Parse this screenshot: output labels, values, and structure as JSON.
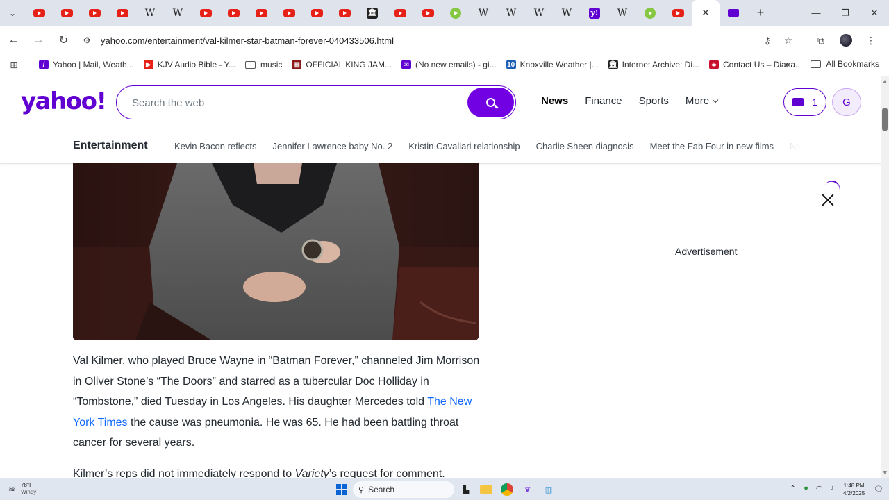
{
  "browser": {
    "tabs": [
      {
        "icon": "youtube-icon",
        "kind": "yt"
      },
      {
        "icon": "youtube-icon",
        "kind": "yt"
      },
      {
        "icon": "youtube-icon",
        "kind": "yt"
      },
      {
        "icon": "youtube-icon",
        "kind": "yt"
      },
      {
        "icon": "wikipedia-icon",
        "kind": "wiki"
      },
      {
        "icon": "wikipedia-icon",
        "kind": "wiki"
      },
      {
        "icon": "youtube-icon",
        "kind": "yt"
      },
      {
        "icon": "youtube-icon",
        "kind": "yt"
      },
      {
        "icon": "youtube-icon",
        "kind": "yt"
      },
      {
        "icon": "youtube-icon",
        "kind": "yt"
      },
      {
        "icon": "youtube-icon",
        "kind": "yt"
      },
      {
        "icon": "youtube-icon",
        "kind": "yt"
      },
      {
        "icon": "internet-archive-icon",
        "kind": "arch"
      },
      {
        "icon": "youtube-icon",
        "kind": "yt"
      },
      {
        "icon": "youtube-icon",
        "kind": "yt"
      },
      {
        "icon": "rumble-icon",
        "kind": "rumble"
      },
      {
        "icon": "wikipedia-icon",
        "kind": "wiki"
      },
      {
        "icon": "wikipedia-icon",
        "kind": "wiki"
      },
      {
        "icon": "wikipedia-icon",
        "kind": "wiki"
      },
      {
        "icon": "wikipedia-icon",
        "kind": "wiki"
      },
      {
        "icon": "yahoo-icon",
        "kind": "yahoo"
      },
      {
        "icon": "wikipedia-icon",
        "kind": "wiki"
      },
      {
        "icon": "rumble-icon",
        "kind": "rumble"
      },
      {
        "icon": "youtube-icon",
        "kind": "yt"
      },
      {
        "icon": "close-icon",
        "kind": "active"
      },
      {
        "icon": "yahoo-mail-icon",
        "kind": "mail"
      }
    ],
    "wiki_glyph": "W",
    "archive_glyph": "🏛",
    "yahoo_glyph": "y!",
    "close_glyph": "✕",
    "new_tab_glyph": "+",
    "url": "yahoo.com/entertainment/val-kilmer-star-batman-forever-040433506.html",
    "bookmarks": [
      {
        "label": "Yahoo | Mail, Weath...",
        "icon": "yahoo-icon",
        "color": "#6001d2",
        "glyph": "/"
      },
      {
        "label": "KJV Audio Bible - Y...",
        "icon": "youtube-icon",
        "color": "#e62117",
        "glyph": "▶"
      },
      {
        "label": "music",
        "icon": "folder-icon",
        "color": "",
        "glyph": ""
      },
      {
        "label": "OFFICIAL KING JAM...",
        "icon": "bible-icon",
        "color": "#8b1a1a",
        "glyph": "▦"
      },
      {
        "label": "(No new emails) - gi...",
        "icon": "mail-icon",
        "color": "#6001d2",
        "glyph": "✉"
      },
      {
        "label": "Knoxville Weather |...",
        "icon": "weather-icon",
        "color": "#1a5db4",
        "glyph": "10"
      },
      {
        "label": "Internet Archive: Di...",
        "icon": "internet-archive-icon",
        "color": "#222",
        "glyph": "🏛"
      },
      {
        "label": "Contact Us – Diana...",
        "icon": "contact-icon",
        "color": "#c8102e",
        "glyph": "◈"
      }
    ],
    "bookmarks_more": "»",
    "all_bookmarks": "All Bookmarks"
  },
  "yahoo": {
    "logo": "yahoo!",
    "search_placeholder": "Search the web",
    "nav": [
      "News",
      "Finance",
      "Sports",
      "More"
    ],
    "mail_count": "1",
    "user_initial": "G",
    "section": "Entertainment",
    "trending": [
      "Kevin Bacon reflects",
      "Jennifer Lawrence baby No. 2",
      "Kristin Cavallari relationship",
      "Charlie Sheen diagnosis",
      "Meet the Fab Four in new films",
      "Ne"
    ]
  },
  "article": {
    "p1_a": "Val Kilmer, who played Bruce Wayne in “Batman Forever,” channeled Jim Morrison in Oliver Stone’s “The Doors” and starred as a tubercular Doc Holliday in “Tombstone,” died Tuesday in Los Angeles. His daughter Mercedes told ",
    "p1_link": "The New York Times",
    "p1_b": " the cause was pneumonia. He was 65. He had been battling throat cancer for several years.",
    "p2_a": "Kilmer’s reps did not immediately respond to ",
    "p2_em": "Variety",
    "p2_b": "’s request for comment."
  },
  "ad": {
    "label": "Advertisement"
  },
  "taskbar": {
    "temp": "78°F",
    "condition": "Windy",
    "search": "Search",
    "time": "1:48 PM",
    "date": "4/2/2025"
  }
}
